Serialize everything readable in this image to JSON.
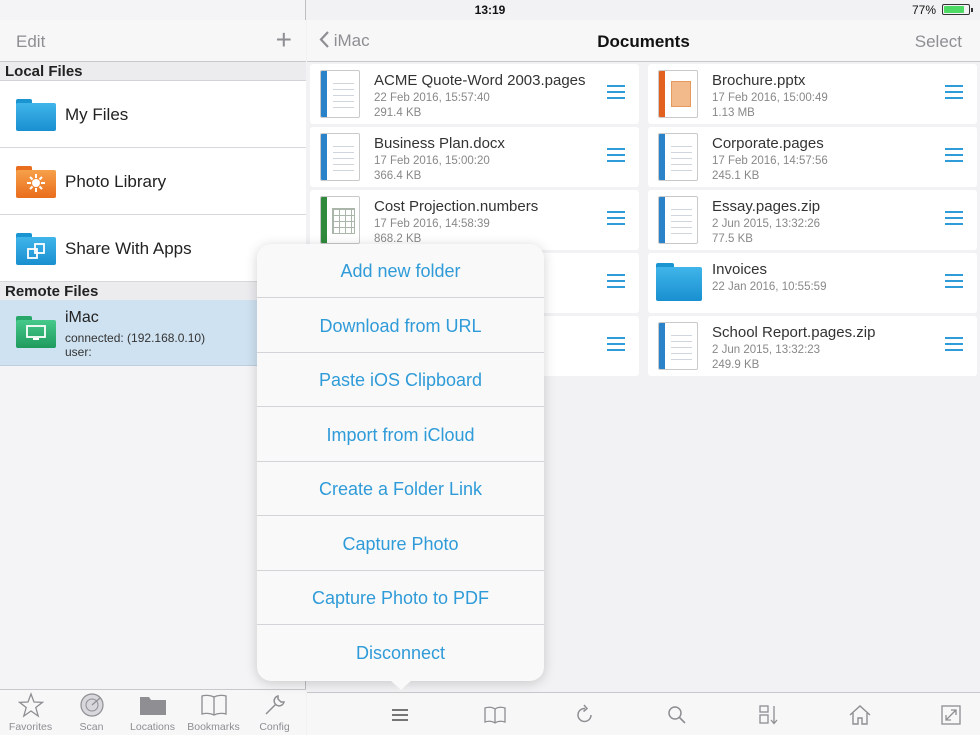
{
  "status": {
    "device": "iPad",
    "time": "13:19",
    "battery_text": "77%",
    "battery_level": 0.77
  },
  "sidebar": {
    "edit_label": "Edit",
    "add_label": "+",
    "local_header": "Local Files",
    "local_items": [
      {
        "label": "My Files",
        "icon": "folder-icon"
      },
      {
        "label": "Photo Library",
        "icon": "photo-library-icon"
      },
      {
        "label": "Share With Apps",
        "icon": "share-apps-icon"
      }
    ],
    "remote_header": "Remote Files",
    "remote": {
      "name": "iMac",
      "connected": "connected: (192.168.0.10)",
      "user": "user:"
    }
  },
  "tabs": [
    {
      "label": "Favorites",
      "icon": "star-icon"
    },
    {
      "label": "Scan",
      "icon": "scan-icon"
    },
    {
      "label": "Locations",
      "icon": "folder-icon"
    },
    {
      "label": "Bookmarks",
      "icon": "book-icon"
    },
    {
      "label": "Config",
      "icon": "wrench-icon"
    }
  ],
  "nav": {
    "back_label": "iMac",
    "title": "Documents",
    "select_label": "Select"
  },
  "files": [
    {
      "name": "ACME Quote-Word 2003.pages",
      "date": "22 Feb 2016, 15:57:40",
      "size": "291.4 KB",
      "kind": "pages"
    },
    {
      "name": "Brochure.pptx",
      "date": "17 Feb 2016, 15:00:49",
      "size": "1.13 MB",
      "kind": "pptx"
    },
    {
      "name": "Business Plan.docx",
      "date": "17 Feb 2016, 15:00:20",
      "size": "366.4 KB",
      "kind": "pages"
    },
    {
      "name": "Corporate.pages",
      "date": "17 Feb 2016, 14:57:56",
      "size": "245.1 KB",
      "kind": "pages"
    },
    {
      "name": "Cost Projection.numbers",
      "date": "17 Feb 2016, 14:58:39",
      "size": "868.2 KB",
      "kind": "numbers"
    },
    {
      "name": "Essay.pages.zip",
      "date": "2 Jun 2015, 13:32:26",
      "size": "77.5 KB",
      "kind": "pages"
    },
    {
      "name": "",
      "date": "",
      "size": "",
      "kind": "hidden"
    },
    {
      "name": "Invoices",
      "date": "22 Jan 2016, 10:55:59",
      "size": "",
      "kind": "folder"
    },
    {
      "name": "",
      "date": "",
      "size": "",
      "kind": "hidden"
    },
    {
      "name": "School Report.pages.zip",
      "date": "2 Jun 2015, 13:32:23",
      "size": "249.9 KB",
      "kind": "pages"
    }
  ],
  "popover": {
    "options": [
      "Add new folder",
      "Download from URL",
      "Paste iOS Clipboard",
      "Import from iCloud",
      "Create a Folder Link",
      "Capture Photo",
      "Capture Photo to PDF",
      "Disconnect"
    ]
  },
  "toolbar": [
    "menu-icon",
    "book-icon",
    "refresh-icon",
    "search-icon",
    "sort-icon",
    "home-icon",
    "resize-icon"
  ],
  "colors": {
    "accent": "#2f9bd8",
    "pages_spine": "#2a83c9",
    "pptx_spine": "#e2611f",
    "numbers_spine": "#2f8a3b",
    "remote_selected_bg": "#cfe2f1"
  }
}
